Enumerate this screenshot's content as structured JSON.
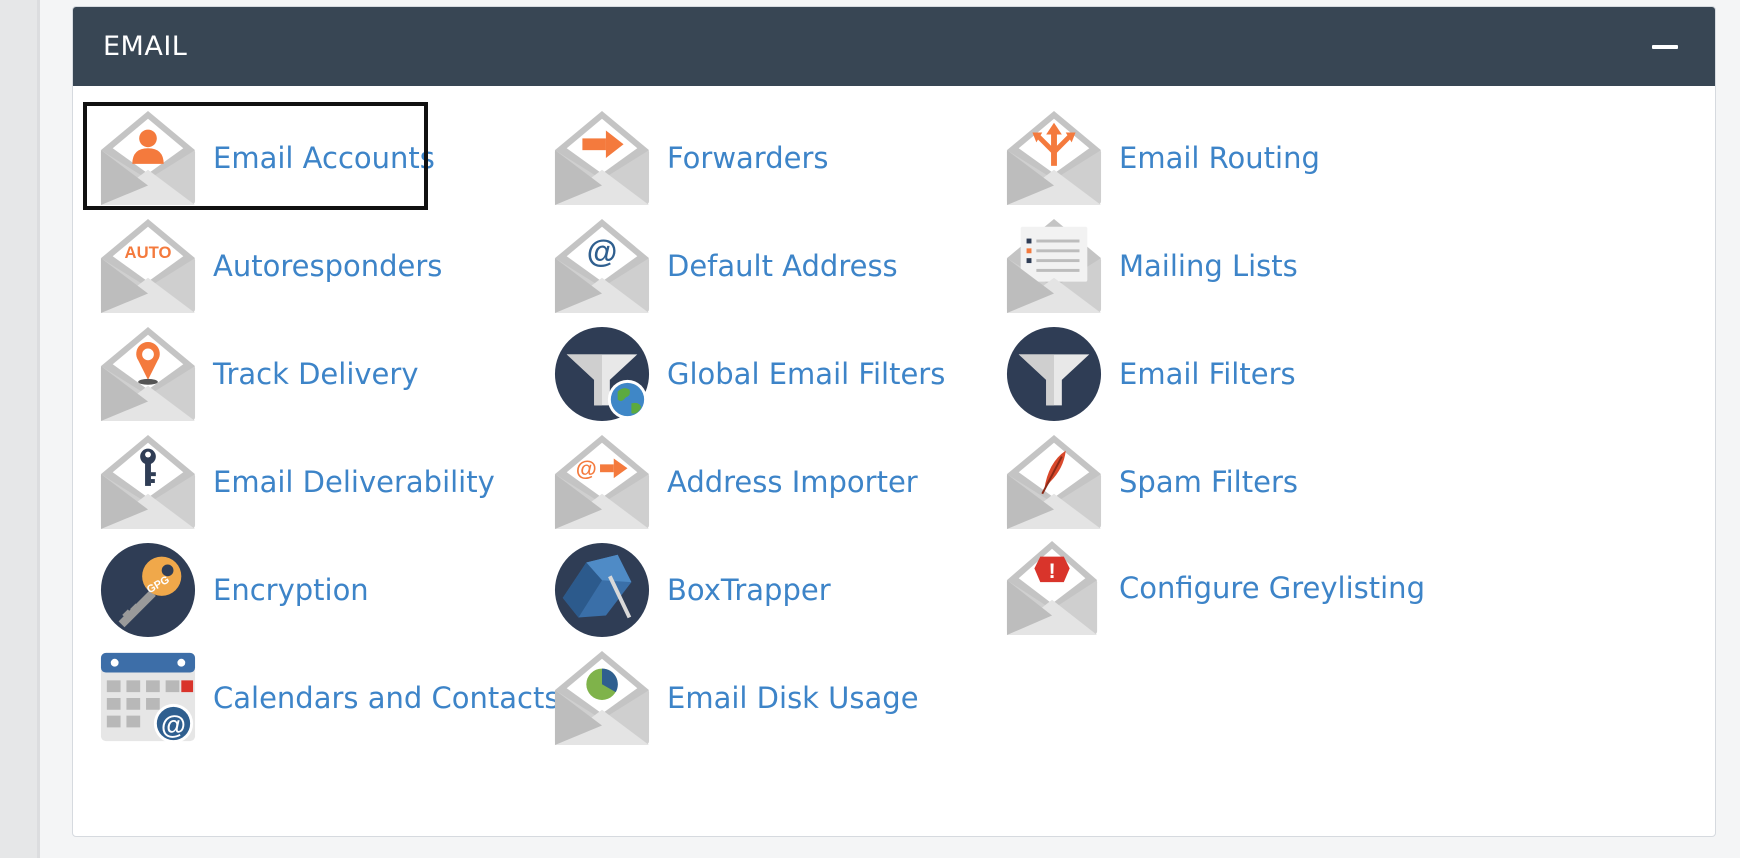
{
  "panel": {
    "title": "EMAIL",
    "collapse_icon": "minus-icon"
  },
  "colors": {
    "header_bg": "#384654",
    "link": "#3d84c8",
    "accent_orange": "#f47a3d",
    "dark_circle": "#2f3d55"
  },
  "items": [
    {
      "label": "Email Accounts",
      "icon": "envelope-user-icon"
    },
    {
      "label": "Forwarders",
      "icon": "envelope-arrow-icon"
    },
    {
      "label": "Email Routing",
      "icon": "envelope-routing-icon"
    },
    {
      "label": "Autoresponders",
      "icon": "envelope-auto-icon",
      "icon_text": "AUTO"
    },
    {
      "label": "Default Address",
      "icon": "envelope-at-icon",
      "icon_text": "@"
    },
    {
      "label": "Mailing Lists",
      "icon": "envelope-list-icon"
    },
    {
      "label": "Track Delivery",
      "icon": "envelope-pin-icon"
    },
    {
      "label": "Global Email Filters",
      "icon": "funnel-globe-icon"
    },
    {
      "label": "Email Filters",
      "icon": "funnel-icon"
    },
    {
      "label": "Email Deliverability",
      "icon": "envelope-key-icon"
    },
    {
      "label": "Address Importer",
      "icon": "envelope-at-arrow-icon",
      "icon_text": "@"
    },
    {
      "label": "Spam Filters",
      "icon": "envelope-feather-icon"
    },
    {
      "label": "Encryption",
      "icon": "gpg-key-icon",
      "icon_text": "GPG"
    },
    {
      "label": "BoxTrapper",
      "icon": "boxtrapper-icon"
    },
    {
      "label": "Configure Greylisting",
      "icon": "envelope-warning-icon",
      "icon_text": "!"
    },
    {
      "label": "Calendars and Contacts",
      "icon": "calendar-at-icon",
      "icon_text": "@"
    },
    {
      "label": "Email Disk Usage",
      "icon": "envelope-pie-icon"
    }
  ]
}
